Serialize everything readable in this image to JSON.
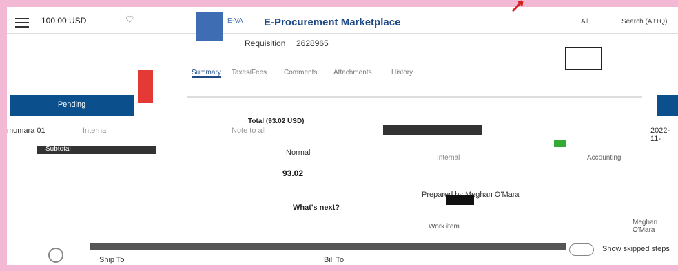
{
  "header": {
    "cart_amount": "100.00 USD",
    "logo_text": "E-VA",
    "app_title": "E-Procurement Marketplace",
    "all_label": "All",
    "search_label": "Search (Alt+Q)"
  },
  "requisition": {
    "title": "Requisition",
    "number": "2628965"
  },
  "tabs": [
    "Summary",
    "Taxes/Fees",
    "Comments",
    "Attachments",
    "History"
  ],
  "status": {
    "pending_label": "Pending",
    "total_label": "Total (93.02 USD)"
  },
  "details": {
    "requester": "momara 01",
    "internal": "Internal",
    "note_to_all": "Note to all",
    "date": "2022-11-",
    "subtotal_label": "Subtotal",
    "priority": "Normal",
    "amount": "93.02",
    "internal2": "Internal",
    "accounting": "Accounting",
    "prepared_by_label": "Prepared by",
    "prepared_by": "Meghan O'Mara",
    "whats_next": "What's next?",
    "work_item": "Work item",
    "assignee": "Meghan O'Mara",
    "show_skipped": "Show skipped steps",
    "ship_to": "Ship To",
    "bill_to": "Bill To"
  },
  "colors": {
    "frame_pink": "#f3b9d4",
    "brand_blue": "#0b4f8c",
    "title_blue": "#204a87",
    "doc_red": "#e53935"
  }
}
